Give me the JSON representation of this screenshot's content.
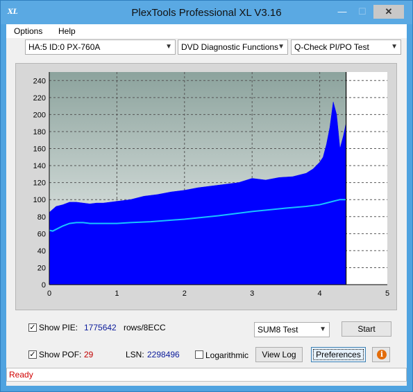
{
  "window": {
    "title": "PlexTools Professional XL V3.16",
    "icon_text": "XL",
    "controls": {
      "minimize": "—",
      "maximize": "☐",
      "close": "✕"
    }
  },
  "menu": {
    "options": "Options",
    "help": "Help"
  },
  "selectors": {
    "drive": "HA:5 ID:0  PX-760A",
    "function": "DVD Diagnostic Functions",
    "test": "Q-Check PI/PO Test"
  },
  "chart_data": {
    "type": "area",
    "xlim": [
      0,
      5
    ],
    "ylim": [
      0,
      250
    ],
    "x_ticks": [
      "0",
      "1",
      "2",
      "3",
      "4",
      "5"
    ],
    "y_ticks": [
      "0",
      "20",
      "40",
      "60",
      "80",
      "100",
      "120",
      "140",
      "160",
      "180",
      "200",
      "220",
      "240"
    ],
    "grid": true,
    "background": "#8fa6a0",
    "end_marker_x": 4.39,
    "series": [
      {
        "type": "area",
        "color": "#0000ff",
        "x": [
          0,
          0.1,
          0.2,
          0.3,
          0.4,
          0.5,
          0.6,
          0.7,
          0.8,
          0.9,
          1.0,
          1.2,
          1.4,
          1.6,
          1.8,
          2.0,
          2.2,
          2.4,
          2.6,
          2.8,
          3.0,
          3.2,
          3.4,
          3.6,
          3.8,
          3.9,
          4.0,
          4.05,
          4.1,
          4.15,
          4.2,
          4.25,
          4.3,
          4.35,
          4.39
        ],
        "y": [
          85,
          92,
          94,
          97,
          97,
          96,
          95,
          96,
          96,
          97,
          98,
          100,
          104,
          106,
          109,
          111,
          114,
          116,
          118,
          120,
          125,
          123,
          126,
          127,
          131,
          136,
          144,
          150,
          165,
          185,
          215,
          200,
          160,
          175,
          190
        ]
      },
      {
        "type": "line",
        "color": "#19c3ff",
        "x": [
          0,
          0.05,
          0.1,
          0.2,
          0.3,
          0.4,
          0.5,
          0.6,
          0.8,
          1.0,
          1.2,
          1.5,
          2.0,
          2.5,
          3.0,
          3.5,
          3.8,
          4.0,
          4.1,
          4.2,
          4.3,
          4.39
        ],
        "y": [
          64,
          63,
          65,
          69,
          72,
          73,
          73,
          72,
          72,
          72,
          73,
          74,
          77,
          81,
          86,
          90,
          92,
          94,
          96,
          98,
          100,
          100
        ]
      }
    ]
  },
  "stats": {
    "show_pie_label": "Show PIE:",
    "pie_value": "1775642",
    "pie_unit": "rows/8ECC",
    "show_pof_label": "Show POF:",
    "pof_value": "29",
    "lsn_label": "LSN:",
    "lsn_value": "2298496",
    "logarithmic_label": "Logarithmic",
    "sum_select": "SUM8 Test"
  },
  "buttons": {
    "start": "Start",
    "view_log": "View Log",
    "preferences": "Preferences",
    "info": "i"
  },
  "status": {
    "text": "Ready"
  }
}
